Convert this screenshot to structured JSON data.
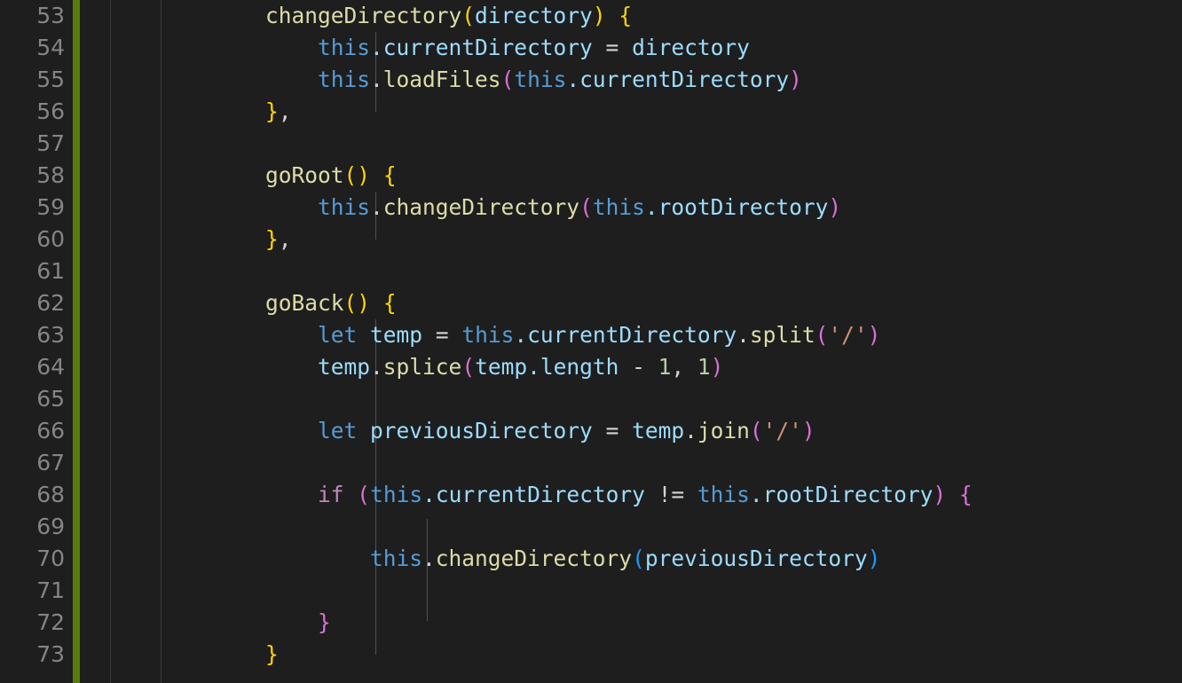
{
  "editor": {
    "app": "code-editor",
    "theme": "dark-plus",
    "language": "javascript",
    "font_size_px": 24,
    "line_height_px": 36,
    "colors": {
      "background": "#1e1e1e",
      "line_number": "#858585",
      "foreground": "#d4d4d4",
      "git_added_bar": "#587c0c",
      "indent_guide": "#515151",
      "separator": "#3a3a3a",
      "function": "#dcdcaa",
      "variable": "#9cdcfe",
      "keyword_control": "#c586c0",
      "keyword_declaration": "#569cd6",
      "number": "#b5cea8",
      "string": "#ce9178",
      "bracket_level_0": "#ffd700",
      "bracket_level_1": "#da70d6",
      "bracket_level_2": "#179fff"
    }
  },
  "gutter": {
    "first_line": 53,
    "last_line": 73,
    "line_numbers": [
      "53",
      "54",
      "55",
      "56",
      "57",
      "58",
      "59",
      "60",
      "61",
      "62",
      "63",
      "64",
      "65",
      "66",
      "67",
      "68",
      "69",
      "70",
      "71",
      "72",
      "73"
    ],
    "git_indicator": "added-modified-bar"
  },
  "code": {
    "lines": [
      {
        "number": "53",
        "text": "    changeDirectory(directory) {"
      },
      {
        "number": "54",
        "text": "        this.currentDirectory = directory"
      },
      {
        "number": "55",
        "text": "        this.loadFiles(this.currentDirectory)"
      },
      {
        "number": "56",
        "text": "    },"
      },
      {
        "number": "57",
        "text": ""
      },
      {
        "number": "58",
        "text": "    goRoot() {"
      },
      {
        "number": "59",
        "text": "        this.changeDirectory(this.rootDirectory)"
      },
      {
        "number": "60",
        "text": "    },"
      },
      {
        "number": "61",
        "text": ""
      },
      {
        "number": "62",
        "text": "    goBack() {"
      },
      {
        "number": "63",
        "text": "        let temp = this.currentDirectory.split('/')"
      },
      {
        "number": "64",
        "text": "        temp.splice(temp.length - 1, 1)"
      },
      {
        "number": "65",
        "text": ""
      },
      {
        "number": "66",
        "text": "        let previousDirectory = temp.join('/')"
      },
      {
        "number": "67",
        "text": ""
      },
      {
        "number": "68",
        "text": "        if (this.currentDirectory != this.rootDirectory) {"
      },
      {
        "number": "69",
        "text": ""
      },
      {
        "number": "70",
        "text": "            this.changeDirectory(previousDirectory)"
      },
      {
        "number": "71",
        "text": ""
      },
      {
        "number": "72",
        "text": "        }"
      },
      {
        "number": "73",
        "text": "    }"
      }
    ],
    "tokens": [
      [
        {
          "t": "    ",
          "c": "t-plain"
        },
        {
          "t": "changeDirectory",
          "c": "t-fn"
        },
        {
          "t": "(",
          "c": "b-yellow"
        },
        {
          "t": "directory",
          "c": "t-var"
        },
        {
          "t": ")",
          "c": "b-yellow"
        },
        {
          "t": " ",
          "c": "t-plain"
        },
        {
          "t": "{",
          "c": "b-yellow"
        }
      ],
      [
        {
          "t": "        ",
          "c": "t-plain"
        },
        {
          "t": "this",
          "c": "t-kw2"
        },
        {
          "t": ".currentDirectory",
          "c": "t-var"
        },
        {
          "t": " = ",
          "c": "t-plain"
        },
        {
          "t": "directory",
          "c": "t-var"
        }
      ],
      [
        {
          "t": "        ",
          "c": "t-plain"
        },
        {
          "t": "this",
          "c": "t-kw2"
        },
        {
          "t": ".",
          "c": "t-plain"
        },
        {
          "t": "loadFiles",
          "c": "t-fn"
        },
        {
          "t": "(",
          "c": "b-magenta"
        },
        {
          "t": "this",
          "c": "t-kw2"
        },
        {
          "t": ".currentDirectory",
          "c": "t-var"
        },
        {
          "t": ")",
          "c": "b-magenta"
        }
      ],
      [
        {
          "t": "    ",
          "c": "t-plain"
        },
        {
          "t": "}",
          "c": "b-yellow"
        },
        {
          "t": ",",
          "c": "t-plain"
        }
      ],
      [],
      [
        {
          "t": "    ",
          "c": "t-plain"
        },
        {
          "t": "goRoot",
          "c": "t-fn"
        },
        {
          "t": "()",
          "c": "b-yellow"
        },
        {
          "t": " ",
          "c": "t-plain"
        },
        {
          "t": "{",
          "c": "b-yellow"
        }
      ],
      [
        {
          "t": "        ",
          "c": "t-plain"
        },
        {
          "t": "this",
          "c": "t-kw2"
        },
        {
          "t": ".",
          "c": "t-plain"
        },
        {
          "t": "changeDirectory",
          "c": "t-fn"
        },
        {
          "t": "(",
          "c": "b-magenta"
        },
        {
          "t": "this",
          "c": "t-kw2"
        },
        {
          "t": ".rootDirectory",
          "c": "t-var"
        },
        {
          "t": ")",
          "c": "b-magenta"
        }
      ],
      [
        {
          "t": "    ",
          "c": "t-plain"
        },
        {
          "t": "}",
          "c": "b-yellow"
        },
        {
          "t": ",",
          "c": "t-plain"
        }
      ],
      [],
      [
        {
          "t": "    ",
          "c": "t-plain"
        },
        {
          "t": "goBack",
          "c": "t-fn"
        },
        {
          "t": "()",
          "c": "b-yellow"
        },
        {
          "t": " ",
          "c": "t-plain"
        },
        {
          "t": "{",
          "c": "b-yellow"
        }
      ],
      [
        {
          "t": "        ",
          "c": "t-plain"
        },
        {
          "t": "let",
          "c": "t-kw2"
        },
        {
          "t": " ",
          "c": "t-plain"
        },
        {
          "t": "temp",
          "c": "t-var"
        },
        {
          "t": " = ",
          "c": "t-plain"
        },
        {
          "t": "this",
          "c": "t-kw2"
        },
        {
          "t": ".currentDirectory",
          "c": "t-var"
        },
        {
          "t": ".",
          "c": "t-plain"
        },
        {
          "t": "split",
          "c": "t-fn"
        },
        {
          "t": "(",
          "c": "b-magenta"
        },
        {
          "t": "'/'",
          "c": "t-str"
        },
        {
          "t": ")",
          "c": "b-magenta"
        }
      ],
      [
        {
          "t": "        ",
          "c": "t-plain"
        },
        {
          "t": "temp",
          "c": "t-var"
        },
        {
          "t": ".",
          "c": "t-plain"
        },
        {
          "t": "splice",
          "c": "t-fn"
        },
        {
          "t": "(",
          "c": "b-magenta"
        },
        {
          "t": "temp",
          "c": "t-var"
        },
        {
          "t": ".length",
          "c": "t-var"
        },
        {
          "t": " - ",
          "c": "t-plain"
        },
        {
          "t": "1",
          "c": "t-num"
        },
        {
          "t": ", ",
          "c": "t-plain"
        },
        {
          "t": "1",
          "c": "t-num"
        },
        {
          "t": ")",
          "c": "b-magenta"
        }
      ],
      [],
      [
        {
          "t": "        ",
          "c": "t-plain"
        },
        {
          "t": "let",
          "c": "t-kw2"
        },
        {
          "t": " ",
          "c": "t-plain"
        },
        {
          "t": "previousDirectory",
          "c": "t-var"
        },
        {
          "t": " = ",
          "c": "t-plain"
        },
        {
          "t": "temp",
          "c": "t-var"
        },
        {
          "t": ".",
          "c": "t-plain"
        },
        {
          "t": "join",
          "c": "t-fn"
        },
        {
          "t": "(",
          "c": "b-magenta"
        },
        {
          "t": "'/'",
          "c": "t-str"
        },
        {
          "t": ")",
          "c": "b-magenta"
        }
      ],
      [],
      [
        {
          "t": "        ",
          "c": "t-plain"
        },
        {
          "t": "if",
          "c": "t-kw"
        },
        {
          "t": " ",
          "c": "t-plain"
        },
        {
          "t": "(",
          "c": "b-magenta"
        },
        {
          "t": "this",
          "c": "t-kw2"
        },
        {
          "t": ".currentDirectory",
          "c": "t-var"
        },
        {
          "t": " != ",
          "c": "t-plain"
        },
        {
          "t": "this",
          "c": "t-kw2"
        },
        {
          "t": ".rootDirectory",
          "c": "t-var"
        },
        {
          "t": ")",
          "c": "b-magenta"
        },
        {
          "t": " ",
          "c": "t-plain"
        },
        {
          "t": "{",
          "c": "b-magenta"
        }
      ],
      [],
      [
        {
          "t": "            ",
          "c": "t-plain"
        },
        {
          "t": "this",
          "c": "t-kw2"
        },
        {
          "t": ".",
          "c": "t-plain"
        },
        {
          "t": "changeDirectory",
          "c": "t-fn"
        },
        {
          "t": "(",
          "c": "b-blue"
        },
        {
          "t": "previousDirectory",
          "c": "t-var"
        },
        {
          "t": ")",
          "c": "b-blue"
        }
      ],
      [],
      [
        {
          "t": "        ",
          "c": "t-plain"
        },
        {
          "t": "}",
          "c": "b-magenta"
        }
      ],
      [
        {
          "t": "    ",
          "c": "t-plain"
        },
        {
          "t": "}",
          "c": "b-yellow"
        }
      ]
    ]
  }
}
